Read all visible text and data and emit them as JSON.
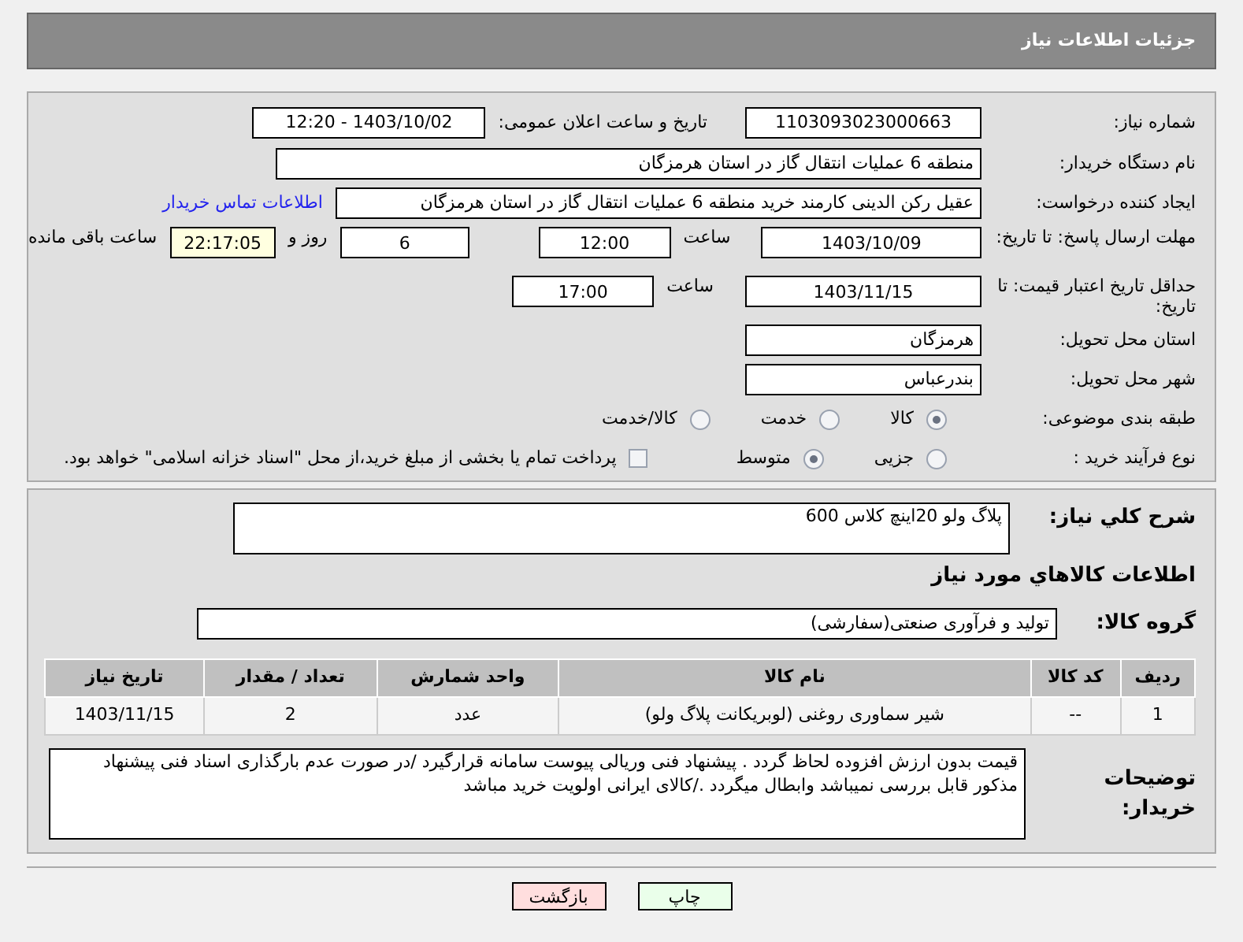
{
  "header": {
    "title": "جزئیات اطلاعات نیاز"
  },
  "need_number": {
    "label": "شماره نیاز:",
    "value": "1103093023000663"
  },
  "announce": {
    "label": "تاریخ و ساعت اعلان عمومی:",
    "value": "1403/10/02 - 12:20"
  },
  "buyer_org": {
    "label": "نام دستگاه خریدار:",
    "value": "منطقه 6 عملیات انتقال گاز در استان هرمزگان"
  },
  "requester": {
    "label": "ایجاد کننده درخواست:",
    "value": "عقیل رکن الدینی کارمند خرید منطقه 6 عملیات انتقال گاز در استان هرمزگان",
    "link": "اطلاعات تماس خریدار"
  },
  "reply_deadline": {
    "label": "مهلت ارسال پاسخ: تا تاریخ:",
    "date": "1403/10/09",
    "time_label": "ساعت",
    "time": "12:00",
    "days": "6",
    "days_label": "روز و",
    "remaining": "22:17:05",
    "remaining_label": "ساعت باقی مانده"
  },
  "price_validity": {
    "label": "حداقل تاریخ اعتبار قیمت: تا تاریخ:",
    "date": "1403/11/15",
    "time_label": "ساعت",
    "time": "17:00"
  },
  "province": {
    "label": "استان محل تحویل:",
    "value": "هرمزگان"
  },
  "city": {
    "label": "شهر محل تحویل:",
    "value": "بندرعباس"
  },
  "category": {
    "label": "طبقه بندی موضوعی:",
    "options": [
      {
        "label": "کالا",
        "selected": true
      },
      {
        "label": "خدمت",
        "selected": false
      },
      {
        "label": "کالا/خدمت",
        "selected": false
      }
    ]
  },
  "process": {
    "label": "نوع فرآیند خرید :",
    "options": [
      {
        "label": "جزیی",
        "selected": false
      },
      {
        "label": "متوسط",
        "selected": true
      }
    ],
    "treasury": {
      "label": "پرداخت تمام یا بخشی از مبلغ خرید،از محل \"اسناد خزانه اسلامی\" خواهد بود.",
      "checked": false
    }
  },
  "summary": {
    "label": "شرح کلي نياز:",
    "value": "پلاگ ولو 20اینچ کلاس 600"
  },
  "goods_heading": "اطلاعات کالاهاي مورد نياز",
  "goods_group": {
    "label": "گروه کالا:",
    "value": "تولید و فرآوری صنعتی(سفارشی)"
  },
  "table": {
    "columns": [
      "ردیف",
      "کد کالا",
      "نام کالا",
      "واحد شمارش",
      "تعداد / مقدار",
      "تاریخ نیاز"
    ],
    "rows": [
      [
        "1",
        "--",
        "شیر سماوری روغنی (لوبریکانت پلاگ ولو)",
        "عدد",
        "2",
        "1403/11/15"
      ]
    ]
  },
  "notes": {
    "label": "توضیحات خریدار:",
    "value": "قیمت بدون ارزش افزوده لحاظ گردد . پیشنهاد فنی وریالی پیوست سامانه قرارگیرد /در صورت عدم بارگذاری اسناد فنی پیشنهاد مذکور قابل بررسی نمیباشد وابطال میگردد ./کالای ایرانی اولویت خرید مباشد"
  },
  "buttons": [
    {
      "label": "چاپ",
      "kind": "print"
    },
    {
      "label": "بازگشت",
      "kind": "back"
    }
  ]
}
